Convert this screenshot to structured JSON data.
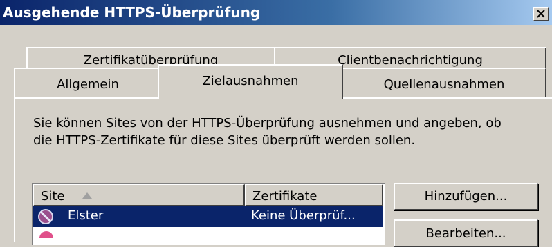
{
  "window": {
    "title": "Ausgehende HTTPS-Überprüfung",
    "close_label": "×"
  },
  "tabs": {
    "row1": [
      {
        "label": "Zertifikatüberprüfung"
      },
      {
        "label": "Clientbenachrichtigung"
      }
    ],
    "row2": [
      {
        "label": "Allgemein"
      },
      {
        "label": "Zielausnahmen",
        "selected": true
      },
      {
        "label": "Quellenausnahmen"
      }
    ]
  },
  "panel": {
    "description_line1": "Sie können Sites von der HTTPS-Überprüfung ausnehmen und angeben, ob",
    "description_line2": "die HTTPS-Zertifikate für diese Sites überprüft werden sollen."
  },
  "list": {
    "columns": [
      {
        "label": "Site",
        "sort": "ascending"
      },
      {
        "label": "Zertifikate"
      }
    ],
    "rows": [
      {
        "site": "Elster",
        "certificates": "Keine Überprüf...",
        "icon": "blocked-icon",
        "selected": true
      }
    ]
  },
  "buttons": {
    "add_mnemonic": "H",
    "add_rest": "inzufügen...",
    "edit_label": "Bearbeiten..."
  },
  "colors": {
    "titlebar_start": "#0a246a",
    "titlebar_end": "#a6caf0",
    "selection": "#0a246a",
    "face": "#d4d0c8"
  }
}
